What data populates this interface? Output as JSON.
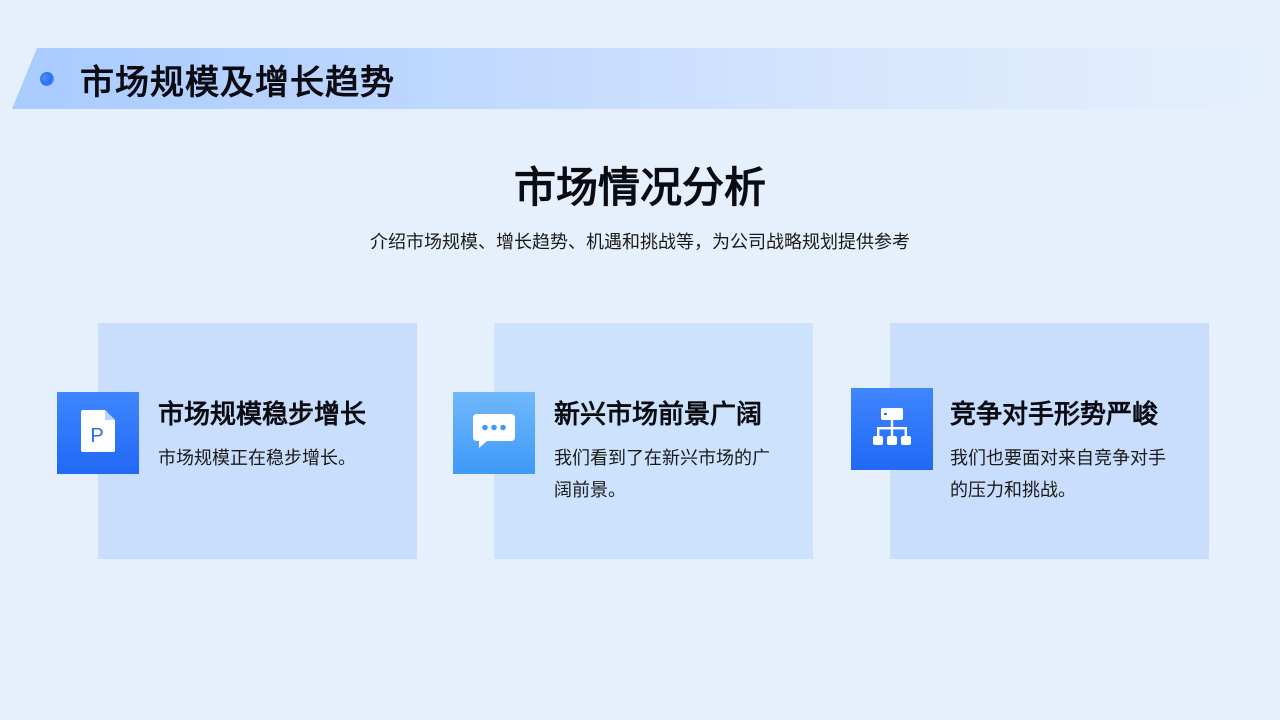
{
  "header": {
    "title": "市场规模及增长趋势"
  },
  "section": {
    "heading": "市场情况分析",
    "subtitle": "介绍市场规模、增长趋势、机遇和挑战等，为公司战略规划提供参考"
  },
  "cards": [
    {
      "icon": "document-p-icon",
      "title": "市场规模稳步增长",
      "description": "市场规模正在稳步增长。"
    },
    {
      "icon": "chat-bubble-icon",
      "title": "新兴市场前景广阔",
      "description": "我们看到了在新兴市场的广阔前景。"
    },
    {
      "icon": "hierarchy-icon",
      "title": "竞争对手形势严峻",
      "description": "我们也要面对来自竞争对手的压力和挑战。"
    }
  ],
  "colors": {
    "background": "#e6f0fd",
    "accent": "#2b6ff5",
    "card_background": "#c9ddfc"
  }
}
